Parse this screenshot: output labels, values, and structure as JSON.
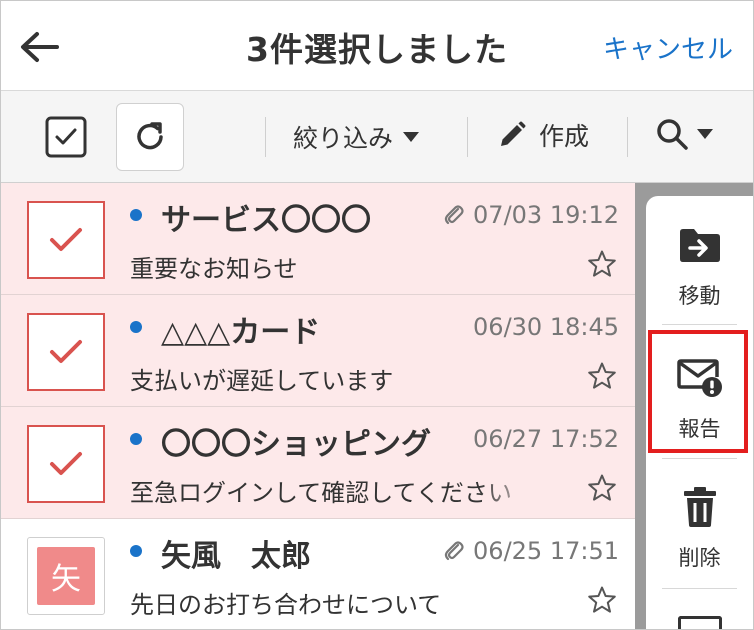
{
  "header": {
    "title": "3件選択しました",
    "cancel_label": "キャンセル"
  },
  "toolbar": {
    "filter_label": "絞り込み",
    "compose_label": "作成"
  },
  "mails": [
    {
      "sender": "サービス〇〇〇",
      "date": "07/03 19:12",
      "subject": "重要なお知らせ",
      "selected": true,
      "attachment": true,
      "unread": true
    },
    {
      "sender": "△△△カード",
      "date": "06/30 18:45",
      "subject": "支払いが遅延しています",
      "selected": true,
      "attachment": false,
      "unread": true
    },
    {
      "sender": "〇〇〇ショッピング",
      "date": "06/27 17:52",
      "subject": "至急ログインして確認してください",
      "selected": true,
      "attachment": false,
      "unread": true
    },
    {
      "sender": "矢風　太郎",
      "date": "06/25 17:51",
      "subject": "先日のお打ち合わせについて",
      "selected": false,
      "attachment": true,
      "unread": true,
      "avatar": "矢"
    }
  ],
  "actions": [
    {
      "label": "移動",
      "icon": "folder-move-icon"
    },
    {
      "label": "報告",
      "icon": "mail-report-icon"
    },
    {
      "label": "削除",
      "icon": "trash-icon"
    }
  ],
  "colors": {
    "accent": "#1a73c9",
    "selected_bg": "#fde9ea",
    "check_red": "#d9534f",
    "highlight": "#e31e1e",
    "avatar_bg": "#f08a8a"
  }
}
